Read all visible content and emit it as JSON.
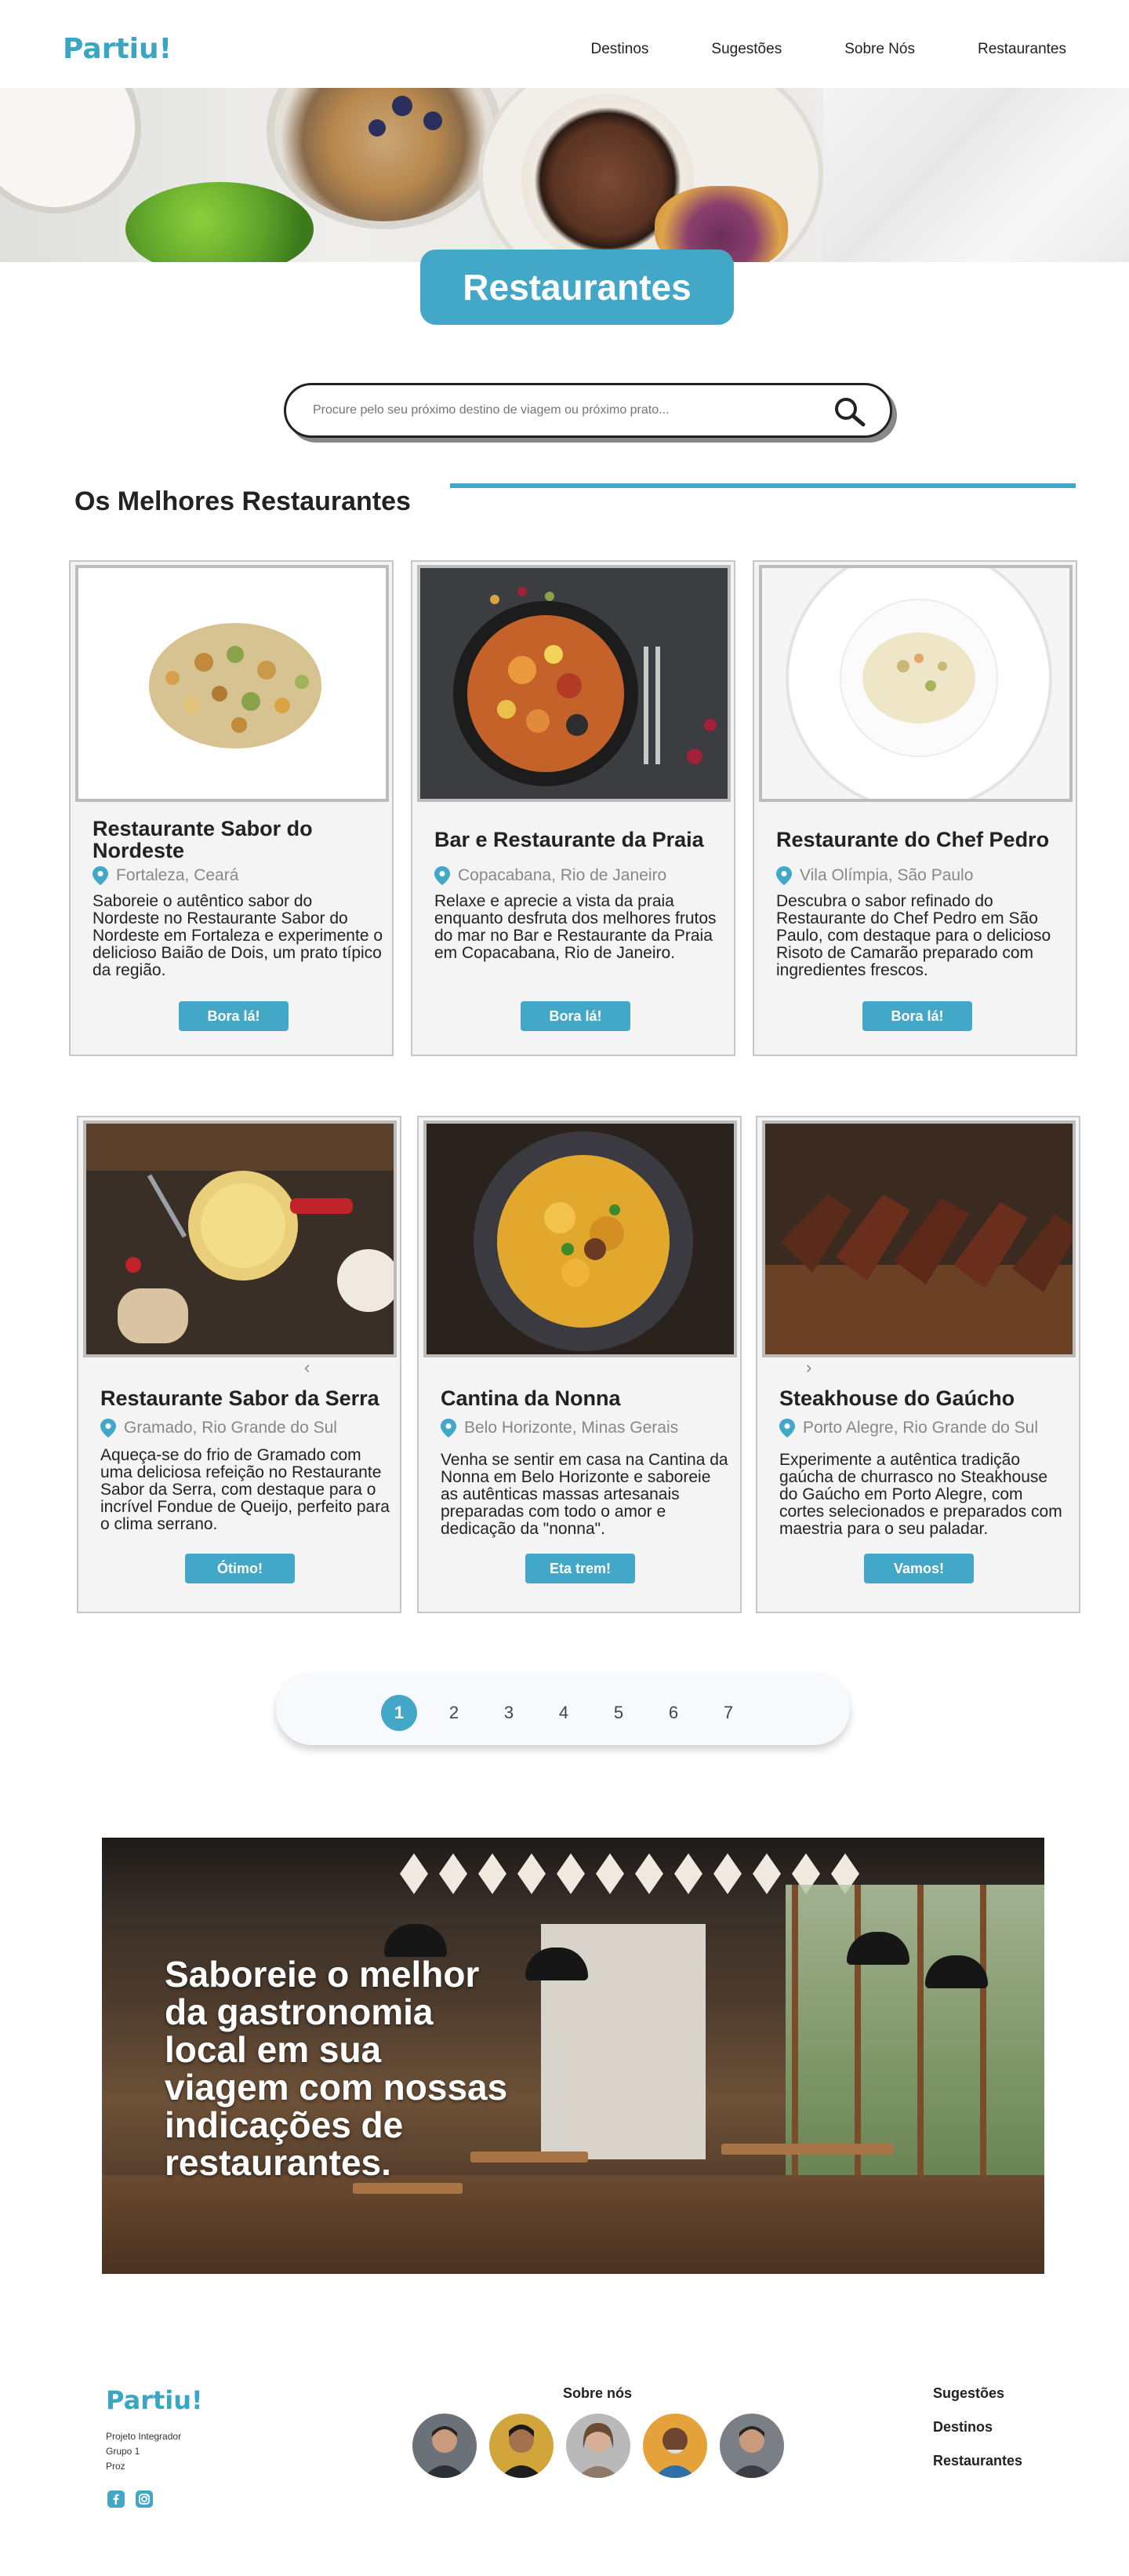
{
  "header": {
    "logo": "Partiu!",
    "nav": [
      "Destinos",
      "Sugestões",
      "Sobre Nós",
      "Restaurantes"
    ]
  },
  "hero": {
    "title": "Restaurantes"
  },
  "search": {
    "placeholder": "Procure pelo seu próximo destino de viagem ou próximo prato..."
  },
  "section": {
    "title": "Os Melhores Restaurantes"
  },
  "cards": [
    {
      "name": "Restaurante Sabor do Nordeste",
      "location": "Fortaleza, Ceará",
      "description": "Saboreie o autêntico sabor do Nordeste no Restaurante Sabor do Nordeste em Fortaleza e experimente o delicioso Baião de Dois, um prato típico da região.",
      "button": "Bora lá!"
    },
    {
      "name": "Bar e Restaurante da Praia",
      "location": "Copacabana, Rio de Janeiro",
      "description": "Relaxe e aprecie a vista da praia enquanto desfruta dos melhores frutos do mar no Bar e Restaurante da Praia em Copacabana, Rio de Janeiro.",
      "button": "Bora lá!"
    },
    {
      "name": "Restaurante do Chef Pedro",
      "location": "Vila Olímpia, São Paulo",
      "description": "Descubra o sabor refinado do Restaurante do Chef Pedro em São Paulo, com destaque para o delicioso Risoto de Camarão preparado com ingredientes frescos.",
      "button": "Bora lá!"
    },
    {
      "name": "Restaurante Sabor da Serra",
      "location": "Gramado, Rio Grande do Sul",
      "description": "Aqueça-se do frio de Gramado com uma deliciosa refeição no Restaurante Sabor da Serra, com destaque para o incrível Fondue de Queijo, perfeito para o clima serrano.",
      "button": "Ótimo!"
    },
    {
      "name": "Cantina da Nonna",
      "location": "Belo Horizonte, Minas Gerais",
      "description": "Venha se sentir em casa na Cantina da Nonna em Belo Horizonte e saboreie as autênticas massas artesanais preparadas com todo o amor e dedicação da \"nonna\".",
      "button": "Eta trem!"
    },
    {
      "name": "Steakhouse do Gaúcho",
      "location": "Porto Alegre, Rio Grande do Sul",
      "description": "Experimente a autêntica tradição gaúcha de churrasco no Steakhouse do Gaúcho em Porto Alegre, com cortes selecionados e preparados com maestria para o seu paladar.",
      "button": "Vamos!"
    }
  ],
  "carousel": {
    "prev": "‹",
    "next": "›"
  },
  "pagination": {
    "pages": [
      "1",
      "2",
      "3",
      "4",
      "5",
      "6",
      "7"
    ],
    "current": "1"
  },
  "banner": {
    "text": "Saboreie o melhor da gastronomia local em sua viagem com nossas indicações de restaurantes."
  },
  "footer": {
    "logo": "Partiu!",
    "info": [
      "Projeto Integrador",
      "Grupo 1",
      "Proz"
    ],
    "about_title": "Sobre nós",
    "links": [
      "Sugestões",
      "Destinos",
      "Restaurantes"
    ],
    "social": [
      "facebook-icon",
      "instagram-icon"
    ]
  },
  "colors": {
    "accent": "#43a8c8",
    "logo": "#3aa6c3",
    "card_bg": "#f4f4f4",
    "text": "#222222"
  }
}
